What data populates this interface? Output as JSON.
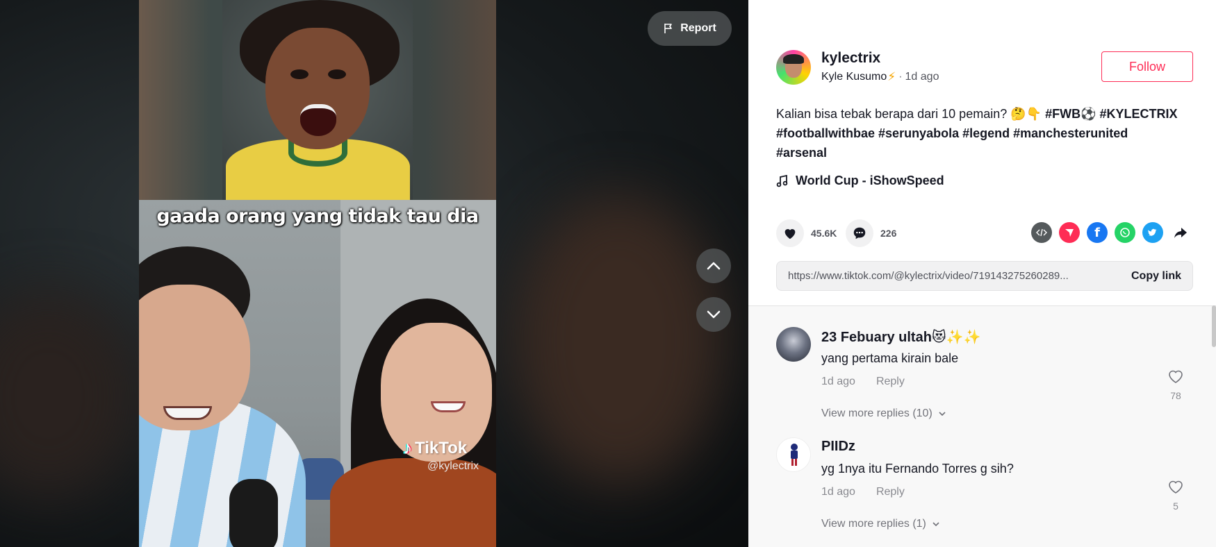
{
  "video": {
    "caption": "gaada orang yang tidak tau dia",
    "watermark_brand": "TikTok",
    "watermark_handle": "@kylectrix",
    "report_label": "Report",
    "icons": {
      "report": "flag-icon",
      "prev": "chevron-up-icon",
      "next": "chevron-down-icon"
    }
  },
  "author": {
    "username": "kylectrix",
    "nickname": "Kyle Kusumo",
    "nickname_emoji": "⚡",
    "separator": "·",
    "posted": "1d ago",
    "follow_label": "Follow"
  },
  "description": {
    "text": "Kalian bisa tebak berapa dari 10 pemain? ",
    "emoji": "🤔👇",
    "hashtags": [
      "#FWB⚽",
      "#KYLECTRIX",
      "#footballwithbae",
      "#serunyabola",
      "#legend",
      "#manchesterunited",
      "#arsenal"
    ]
  },
  "music": {
    "title": "World Cup - iShowSpeed",
    "icon": "music-note-icon"
  },
  "actions": {
    "likes": "45.6K",
    "comments": "226",
    "share_icons": [
      "embed-icon",
      "send-icon",
      "facebook-icon",
      "whatsapp-icon",
      "twitter-icon",
      "share-arrow-icon"
    ]
  },
  "link": {
    "url": "https://www.tiktok.com/@kylectrix/video/719143275260289...",
    "copy_label": "Copy link"
  },
  "comments": [
    {
      "name": "23 Febuary ultah😻✨✨",
      "text": "yang pertama kirain bale",
      "time": "1d ago",
      "reply_label": "Reply",
      "likes": "78",
      "more_replies": "View more replies (10)"
    },
    {
      "name": "PIIDz",
      "text": "yg 1nya itu Fernando Torres g sih?",
      "time": "1d ago",
      "reply_label": "Reply",
      "likes": "5",
      "more_replies": "View more replies (1)"
    }
  ],
  "colors": {
    "accent": "#fe2c55",
    "facebook": "#1877f2",
    "whatsapp": "#25d366",
    "twitter": "#1da1f2",
    "embed": "#555a5c",
    "send": "#fe2c55"
  }
}
